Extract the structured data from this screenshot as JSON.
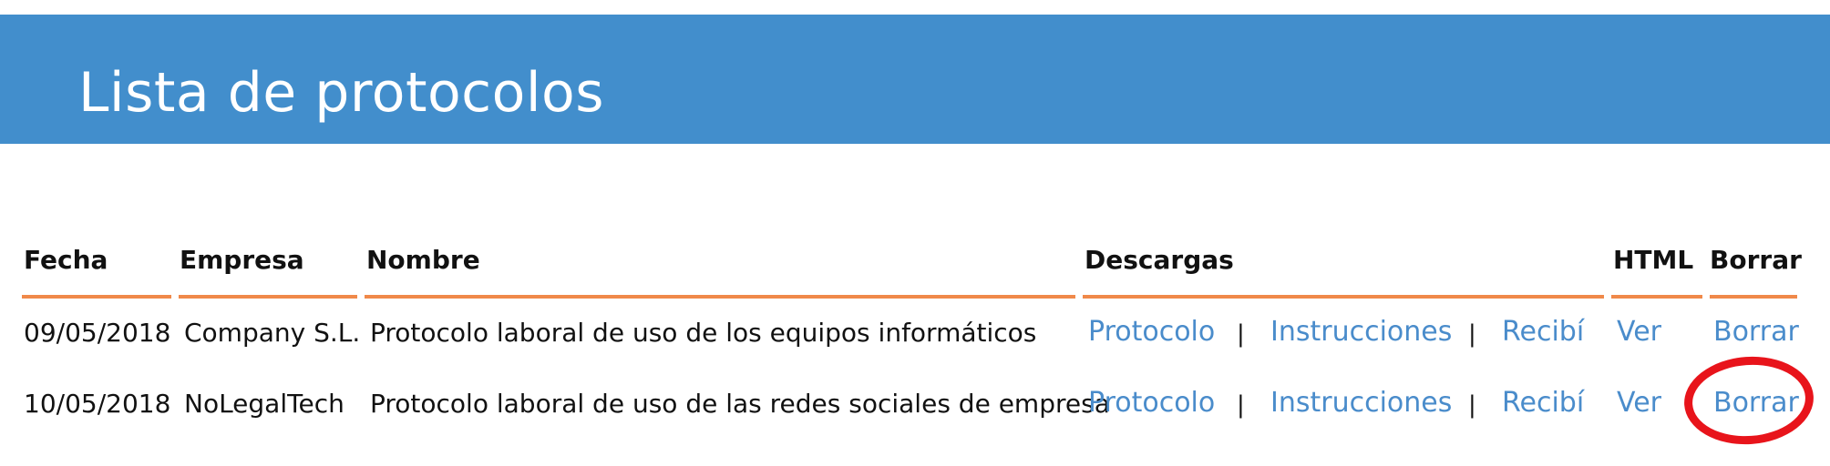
{
  "header": {
    "title": "Lista de protocolos",
    "background_color": "#428ecc"
  },
  "table": {
    "columns": [
      "Fecha",
      "Empresa",
      "Nombre",
      "Descargas",
      "HTML",
      "Borrar"
    ],
    "header_rule_color": "#f0894a",
    "link_color": "#4a8ccb",
    "separator": "|",
    "rows": [
      {
        "fecha": "09/05/2018",
        "empresa": "Company S.L.",
        "nombre": "Protocolo laboral de uso de los equipos informáticos",
        "descargas": [
          "Protocolo",
          "Instrucciones",
          "Recibí"
        ],
        "html": "Ver",
        "borrar": "Borrar"
      },
      {
        "fecha": "10/05/2018",
        "empresa": "NoLegalTech",
        "nombre": "Protocolo laboral de uso de las redes sociales de empresa",
        "descargas": [
          "Protocolo",
          "Instrucciones",
          "Recibí"
        ],
        "html": "Ver",
        "borrar": "Borrar"
      }
    ]
  },
  "annotation": {
    "highlight_color": "#e8141b",
    "highlighted_element": "row-2-borrar-link"
  }
}
